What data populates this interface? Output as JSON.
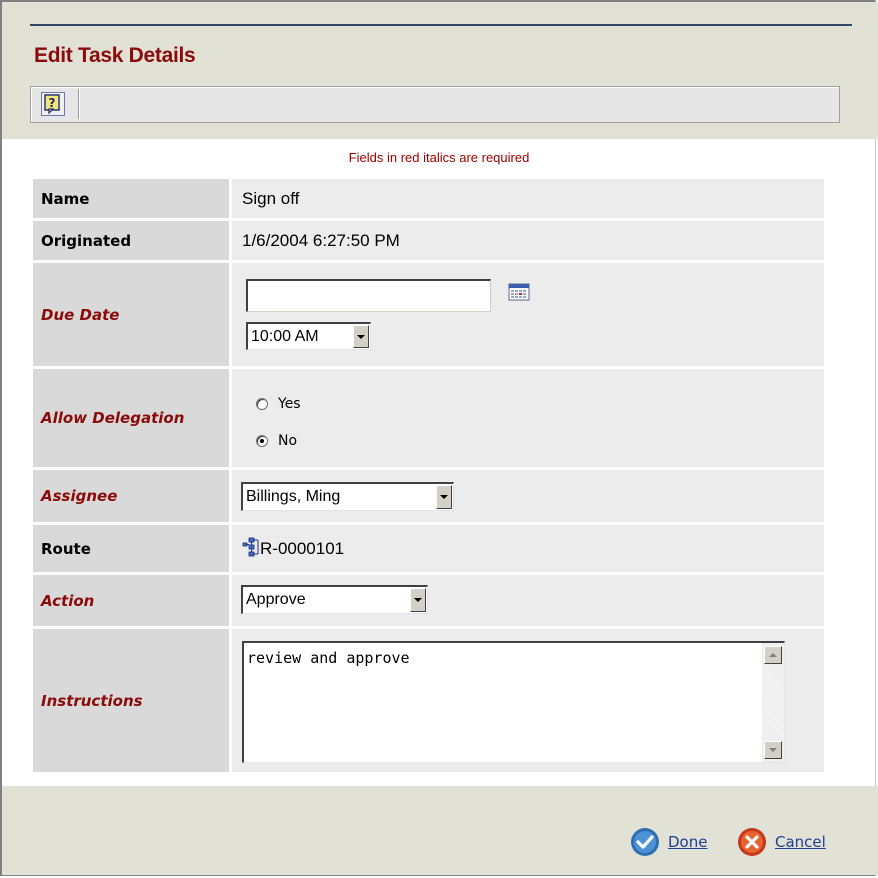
{
  "page": {
    "title": "Edit Task Details",
    "required_note": "Fields in red italics are required"
  },
  "toolbar": {
    "help_icon": "help-icon"
  },
  "fields": {
    "name": {
      "label": "Name",
      "value": "Sign off"
    },
    "originated": {
      "label": "Originated",
      "value": "1/6/2004 6:27:50 PM"
    },
    "due_date": {
      "label": "Due Date",
      "date_value": "",
      "time_value": "10:00 AM",
      "calendar_icon": "calendar-icon"
    },
    "allow_delegation": {
      "label": "Allow Delegation",
      "options": [
        "Yes",
        "No"
      ],
      "selected": "No"
    },
    "assignee": {
      "label": "Assignee",
      "value": "Billings, Ming"
    },
    "route": {
      "label": "Route",
      "value": "R-0000101",
      "icon": "route-icon"
    },
    "action": {
      "label": "Action",
      "value": "Approve"
    },
    "instructions": {
      "label": "Instructions",
      "value": "review and approve"
    }
  },
  "footer": {
    "done_label": "Done",
    "cancel_label": "Cancel"
  },
  "colors": {
    "title_red": "#8b0a0a",
    "required_label": "#8b0a0a",
    "header_bg": "#e1e1d6",
    "link_blue": "#1f3f8f"
  }
}
